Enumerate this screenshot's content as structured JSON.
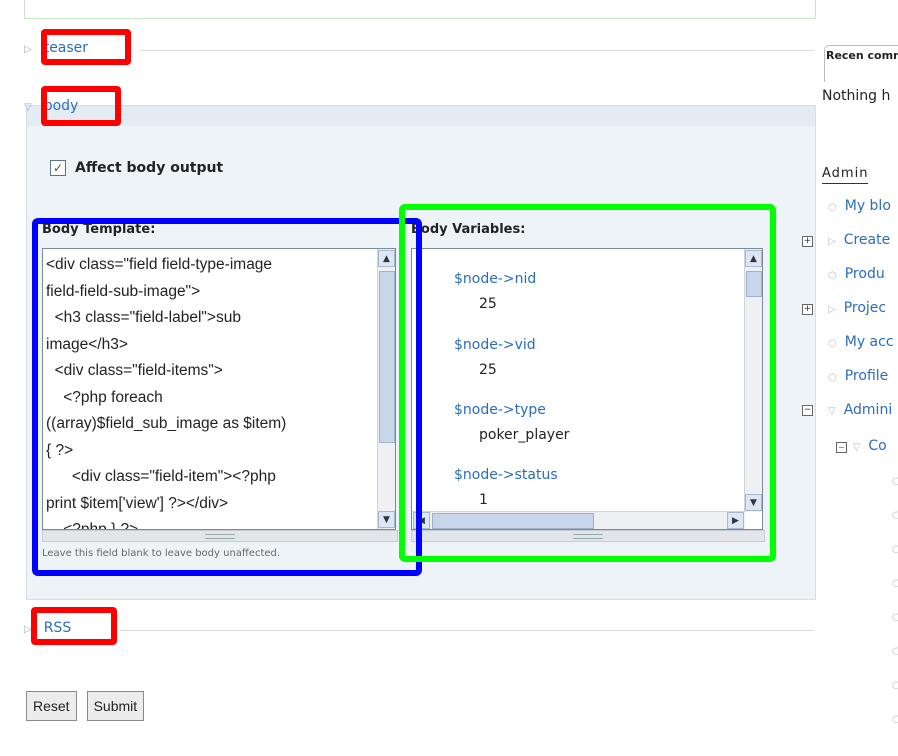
{
  "fieldsets": {
    "teaser": "teaser",
    "body": "body",
    "rss": "RSS"
  },
  "body_section": {
    "checkbox_label": "Affect body output",
    "template_label": "Body Template:",
    "template_code": "<div class=\"field field-type-image\nfield-field-sub-image\">\n  <h3 class=\"field-label\">sub\nimage</h3>\n  <div class=\"field-items\">\n    <?php foreach\n((array)$field_sub_image as $item)\n{ ?>\n      <div class=\"field-item\"><?php\nprint $item['view'] ?></div>\n    <?php } ?>",
    "template_help": "Leave this field blank to leave body unaffected.",
    "variables_label": "Body Variables:",
    "variables": [
      {
        "name": "$node->nid",
        "value": "25"
      },
      {
        "name": "$node->vid",
        "value": "25"
      },
      {
        "name": "$node->type",
        "value": "poker_player"
      },
      {
        "name": "$node->status",
        "value": "1"
      }
    ]
  },
  "buttons": {
    "reset": "Reset",
    "submit": "Submit"
  },
  "sidebar": {
    "tab_label": "Recen comme",
    "nothing_text": "Nothing h",
    "admin_title": "Admin",
    "items": [
      "My blo",
      "Create",
      "Produ",
      "Projec",
      "My acc",
      "Profile",
      "Admini",
      "Co"
    ]
  },
  "annotation_colors": {
    "red": "#ff0000",
    "blue": "#0000ff",
    "green": "#00ff00"
  }
}
